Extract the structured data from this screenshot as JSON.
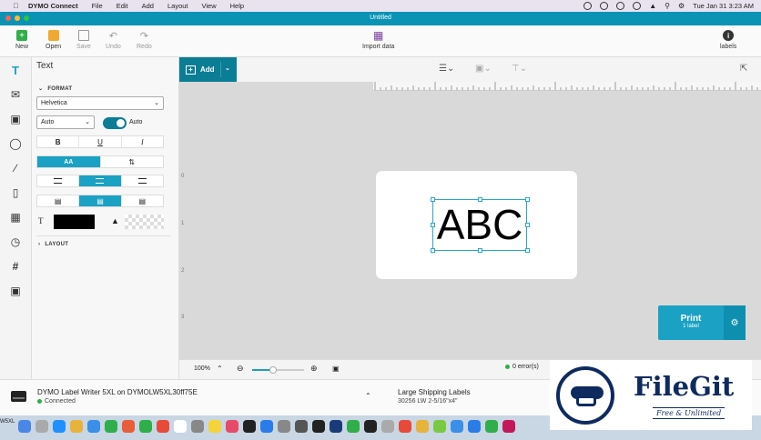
{
  "menubar": {
    "app_name": "DYMO Connect",
    "menus": [
      "File",
      "Edit",
      "Add",
      "Layout",
      "View",
      "Help"
    ],
    "clock": "Tue Jan 31  3:23 AM"
  },
  "window": {
    "title": "Untitled"
  },
  "toolbar": {
    "new_label": "New",
    "open_label": "Open",
    "save_label": "Save",
    "undo_label": "Undo",
    "redo_label": "Redo",
    "import_label": "Import data",
    "labels_label": "labels"
  },
  "panel": {
    "title": "Text",
    "format_section": "FORMAT",
    "font_family": "Helvetica",
    "font_size": "Auto",
    "autofit_label": "Auto",
    "bold": "B",
    "underline": "U",
    "italic": "I",
    "caps_label": "AA",
    "text_color_label": "T",
    "layout_section": "LAYOUT"
  },
  "canvas": {
    "add_label": "Add",
    "label_text": "ABC",
    "ruler_left": [
      "0",
      "1",
      "2",
      "3"
    ]
  },
  "print": {
    "title": "Print",
    "count": "1 label"
  },
  "zoom": {
    "level": "100%",
    "level_value": 100,
    "errors": "0 error(s)"
  },
  "status": {
    "printer": "DYMO Label Writer 5XL on DYMOLW5XL30ff75E",
    "printer_state": "Connected",
    "label_name": "Large Shipping Labels",
    "label_info": "30256     LW 2-5/16\"x4\""
  },
  "dock": {
    "clipped_label": "W5XL"
  },
  "watermark": {
    "brand": "FileGit",
    "tagline": "Free & Unlimited"
  },
  "colors": {
    "accent": "#1aa1c3",
    "titlebar": "#0a93b5",
    "add_button": "#0b7d95",
    "text_color": "#000000"
  }
}
